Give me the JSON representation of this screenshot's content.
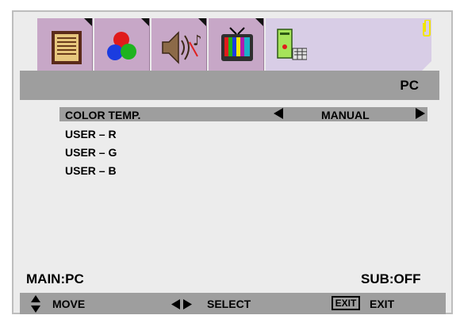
{
  "header": {
    "title": "PC"
  },
  "tabs": [
    {
      "name": "picture-menu-icon",
      "active": false
    },
    {
      "name": "color-menu-icon",
      "active": false
    },
    {
      "name": "audio-menu-icon",
      "active": false
    },
    {
      "name": "tv-menu-icon",
      "active": false
    },
    {
      "name": "pc-menu-icon",
      "active": true
    }
  ],
  "menu": {
    "rows": [
      {
        "label": "COLOR   TEMP.",
        "value": "MANUAL",
        "selected": true
      },
      {
        "label": "USER – R"
      },
      {
        "label": "USER – G"
      },
      {
        "label": "USER – B"
      }
    ]
  },
  "status": {
    "main": "MAIN:PC",
    "sub": "SUB:OFF"
  },
  "footer": {
    "move": "MOVE",
    "select": "SELECT",
    "exit_key": "EXIT",
    "exit_label": "EXIT"
  },
  "colors": {
    "tab_bg": "#c7a7c7",
    "active_tab_bg": "#d8cde6",
    "bar": "#9e9e9e",
    "frame": "#ececec",
    "clip_icon": "#f2e600"
  }
}
